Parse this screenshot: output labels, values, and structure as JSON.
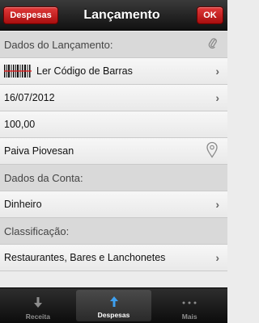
{
  "navbar": {
    "back_label": "Despesas",
    "title": "Lançamento",
    "ok_label": "OK",
    "accent_color": "#c41c1c"
  },
  "list": {
    "section_lancamento": "Dados do Lançamento:",
    "barcode_label": "Ler Código de Barras",
    "date": "16/07/2012",
    "amount": "100,00",
    "location": "Paiva Piovesan",
    "section_conta": "Dados da Conta:",
    "conta_value": "Dinheiro",
    "section_classificacao": "Classificação:",
    "classificacao_value": "Restaurantes, Bares e Lanchonetes"
  },
  "tabbar": {
    "tabs": [
      {
        "label": "Receita",
        "icon": "arrow-down-icon"
      },
      {
        "label": "Despesas",
        "icon": "arrow-up-icon"
      },
      {
        "label": "Mais",
        "icon": "more-dots-icon"
      }
    ],
    "active_tab": "Despesas"
  }
}
